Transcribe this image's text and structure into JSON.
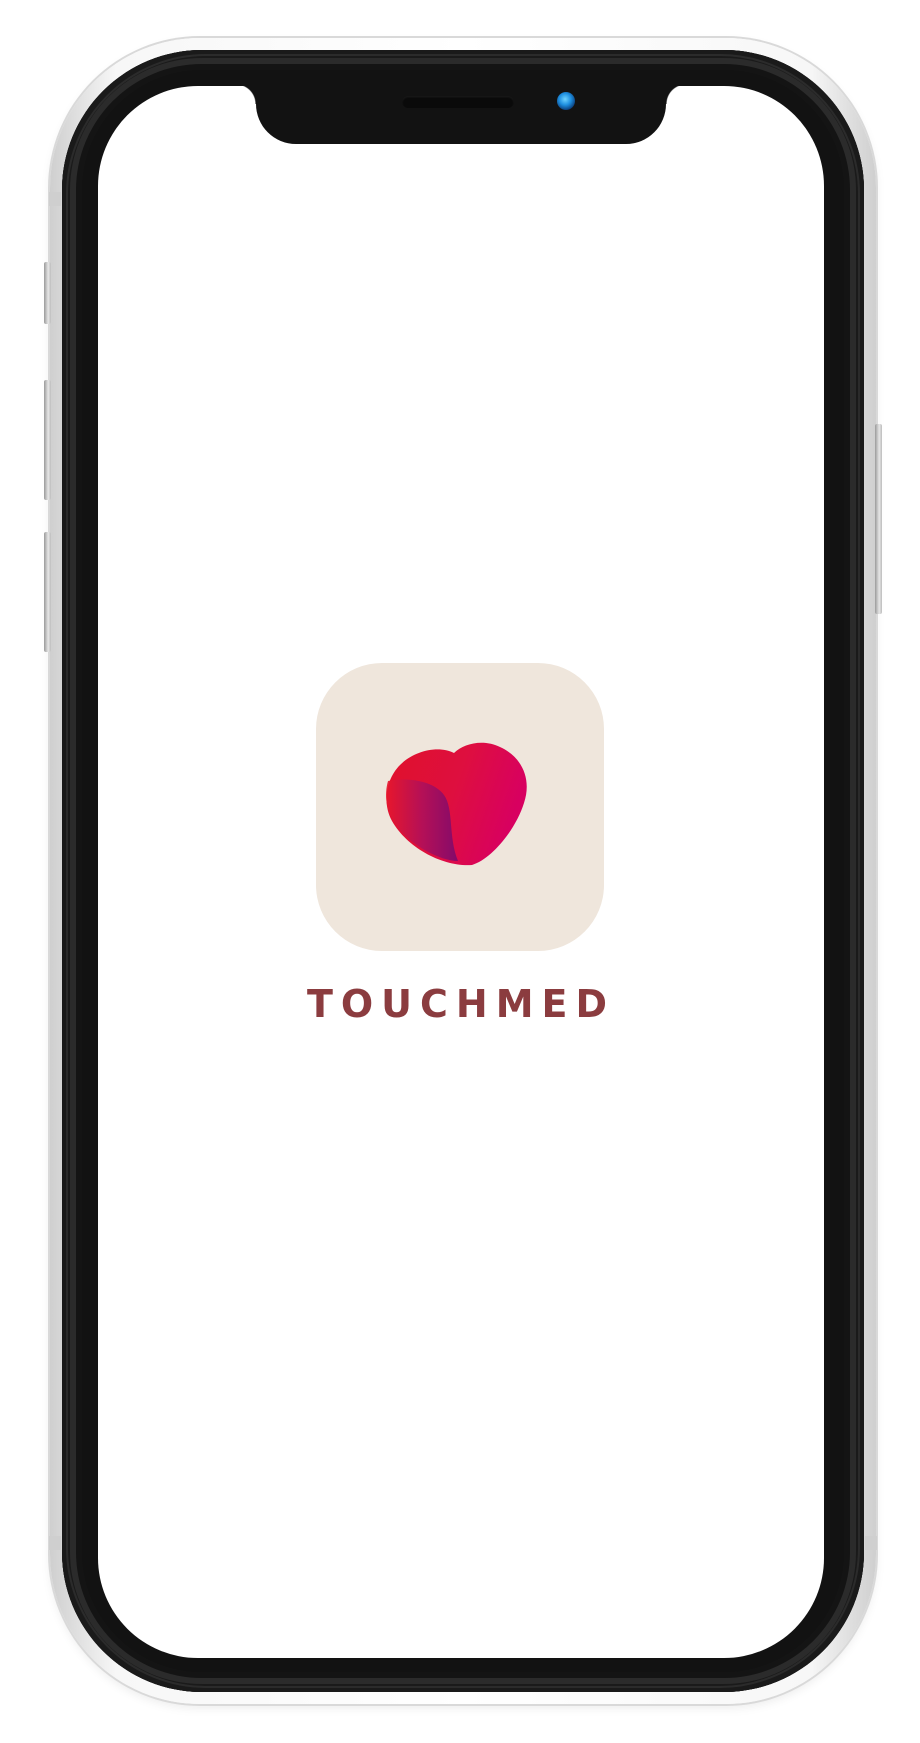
{
  "splash": {
    "brand_name": "TOUCHMED",
    "logo_icon": "heart-logo-icon",
    "tile_color": "#efe6dc",
    "brand_color": "#8b3c3f"
  },
  "device": {
    "frame_color": "#121212",
    "camera_icon": "front-camera-icon",
    "speaker_icon": "earpiece-speaker-icon"
  },
  "colors": {
    "heart_red": "#e0102a",
    "heart_magenta": "#d80060",
    "heart_purple": "#7a0a6e"
  }
}
